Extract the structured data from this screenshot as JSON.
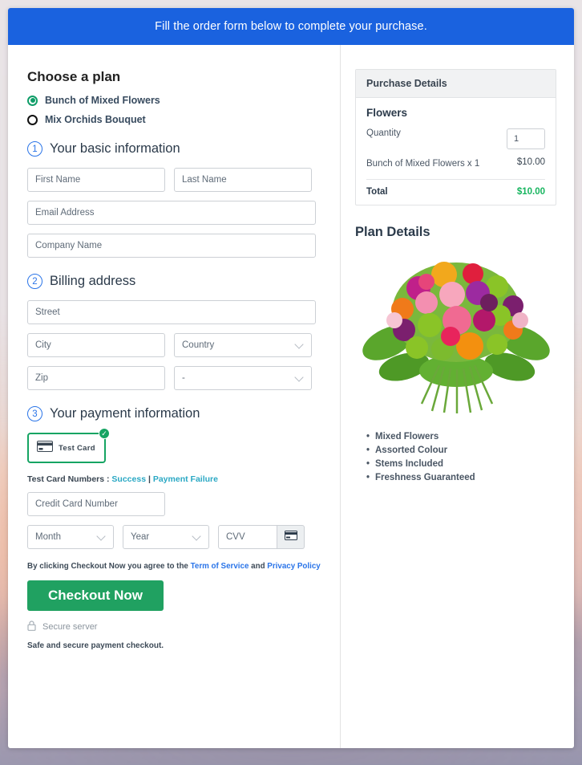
{
  "banner": {
    "message": "Fill the order form below to complete your purchase."
  },
  "plan": {
    "heading": "Choose a plan",
    "options": [
      {
        "label": "Bunch of Mixed Flowers",
        "selected": true
      },
      {
        "label": "Mix Orchids Bouquet",
        "selected": false
      }
    ]
  },
  "steps": {
    "basic": {
      "number": "1",
      "label": "Your basic information"
    },
    "billing": {
      "number": "2",
      "label": "Billing address"
    },
    "payment": {
      "number": "3",
      "label": "Your payment information"
    }
  },
  "fields": {
    "first_name": "First Name",
    "last_name": "Last Name",
    "email": "Email Address",
    "company": "Company Name",
    "street": "Street",
    "city": "City",
    "country": "Country",
    "zip": "Zip",
    "state": "-",
    "card_number": "Credit Card Number",
    "month": "Month",
    "year": "Year",
    "cvv": "CVV"
  },
  "payment": {
    "test_card_label": "Test Card",
    "card_icon": "credit-card-icon",
    "badge_icon": "check-circle-icon",
    "test_numbers_prefix": "Test Card Numbers :",
    "success_link": "Success",
    "separator": "|",
    "failure_link": "Payment Failure",
    "cvv_icon": "credit-card-icon"
  },
  "terms": {
    "prefix": "By clicking Checkout Now you agree to the",
    "tos_link": "Term of Service",
    "and": "and",
    "privacy_link": "Privacy Policy"
  },
  "actions": {
    "checkout_label": "Checkout Now",
    "secure_server": "Secure server",
    "lock_icon": "lock-icon",
    "safe_note": "Safe and secure payment checkout."
  },
  "purchase_details": {
    "title": "Purchase Details",
    "product_group": "Flowers",
    "quantity_label": "Quantity",
    "quantity_value": "1",
    "line_item": "Bunch of Mixed Flowers x 1",
    "line_price": "$10.00",
    "total_label": "Total",
    "total_amount": "$10.00"
  },
  "plan_details": {
    "title": "Plan Details",
    "image_alt": "mixed-flower-bouquet",
    "features": [
      "Mixed Flowers",
      "Assorted Colour",
      "Stems Included",
      "Freshness Guaranteed"
    ]
  },
  "colors": {
    "banner_blue": "#1a62df",
    "accent_green": "#20a161",
    "selected_green": "#16a463",
    "link_blue": "#2a74e8",
    "link_teal": "#2aa8c4",
    "step_blue": "#2a74e8",
    "total_green": "#17b55f"
  }
}
